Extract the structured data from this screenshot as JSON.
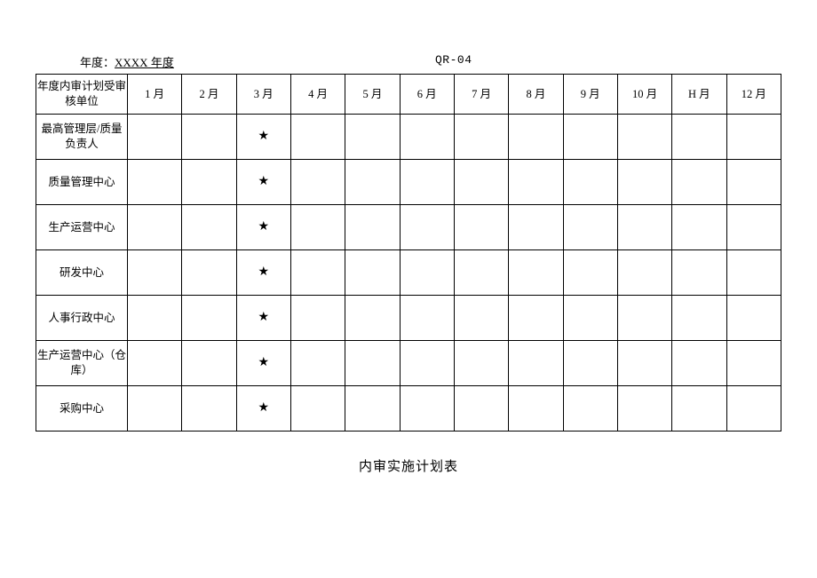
{
  "meta": {
    "year_label": "年度：",
    "year_value": "XXXX 年度",
    "code": "QR-04"
  },
  "columns": {
    "row_header": "年度内审计划受审核单位",
    "months": [
      "1 月",
      "2 月",
      "3 月",
      "4 月",
      "5 月",
      "6 月",
      "7 月",
      "8 月",
      "9 月",
      "10 月",
      "H 月",
      "12 月"
    ]
  },
  "rows": [
    {
      "label": "最高管理层/质量负责人",
      "marks": [
        "",
        "",
        "★",
        "",
        "",
        "",
        "",
        "",
        "",
        "",
        "",
        ""
      ]
    },
    {
      "label": "质量管理中心",
      "marks": [
        "",
        "",
        "★",
        "",
        "",
        "",
        "",
        "",
        "",
        "",
        "",
        ""
      ]
    },
    {
      "label": "生产运营中心",
      "marks": [
        "",
        "",
        "★",
        "",
        "",
        "",
        "",
        "",
        "",
        "",
        "",
        ""
      ]
    },
    {
      "label": "研发中心",
      "marks": [
        "",
        "",
        "★",
        "",
        "",
        "",
        "",
        "",
        "",
        "",
        "",
        ""
      ]
    },
    {
      "label": "人事行政中心",
      "marks": [
        "",
        "",
        "★",
        "",
        "",
        "",
        "",
        "",
        "",
        "",
        "",
        ""
      ]
    },
    {
      "label": "生产运营中心（仓库）",
      "marks": [
        "",
        "",
        "★",
        "",
        "",
        "",
        "",
        "",
        "",
        "",
        "",
        ""
      ]
    },
    {
      "label": "采购中心",
      "marks": [
        "",
        "",
        "★",
        "",
        "",
        "",
        "",
        "",
        "",
        "",
        "",
        ""
      ]
    }
  ],
  "footer_title": "内审实施计划表"
}
